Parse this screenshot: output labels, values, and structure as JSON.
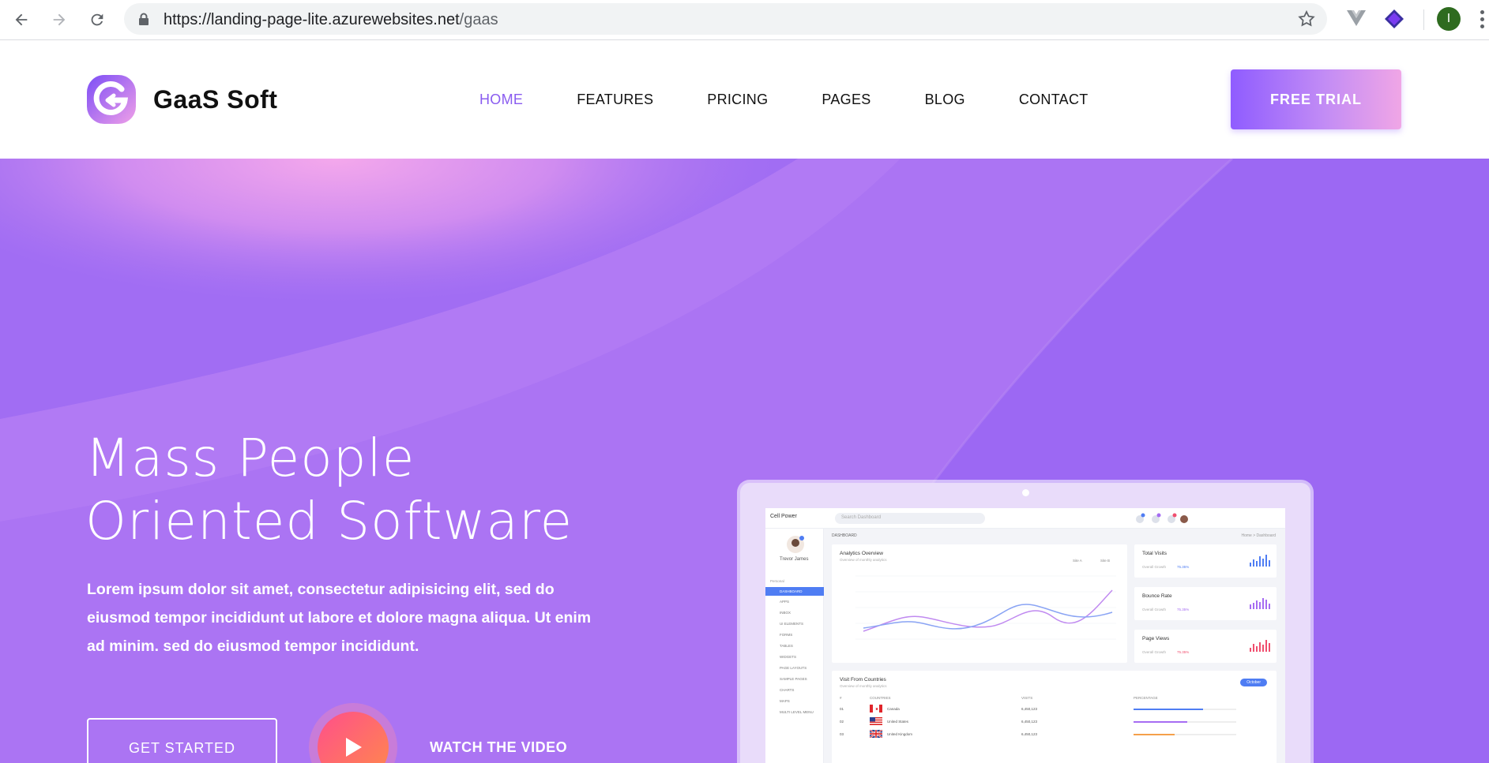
{
  "browser": {
    "url_host": "https://landing-page-lite.azurewebsites.net",
    "url_path": "/gaas",
    "profile_initial": "I"
  },
  "header": {
    "brand": "GaaS Soft",
    "nav": [
      "HOME",
      "FEATURES",
      "PRICING",
      "PAGES",
      "BLOG",
      "CONTACT"
    ],
    "active_nav": "HOME",
    "cta": "FREE TRIAL"
  },
  "hero": {
    "title_line1": "Mass People",
    "title_line2": "Oriented Software",
    "description": "Lorem ipsum dolor sit amet, consectetur adipisicing elit, sed do eiusmod tempor incididunt ut labore et dolore magna aliqua. Ut enim ad minim. sed do eiusmod tempor incididunt.",
    "primary_button": "GET STARTED",
    "video_link": "WATCH THE VIDEO"
  },
  "mockup": {
    "brand": "Cell Power",
    "search_placeholder": "Search Dashboard",
    "user_name": "Trevor James",
    "section_label": "Personal",
    "breadcrumb": "DASHBOARD",
    "breadcrumb_right": "Home  >  Dashboard",
    "sidebar_items": [
      "DASHBOARD",
      "APPS",
      "INBOX",
      "UI ELEMENTS",
      "FORMS",
      "TABLES",
      "WIDGETS",
      "PAGE LAYOUTS",
      "SAMPLE PAGES",
      "CHARTS",
      "MAPS",
      "MULTI LEVEL MENU"
    ],
    "analytics": {
      "title": "Analytics Overview",
      "subtitle": "Overview of monthly analytics",
      "legend": [
        "Site A",
        "Site B"
      ]
    },
    "stats": [
      {
        "title": "Total Visits",
        "sub": "Overall Growth",
        "pct": "75.35%",
        "color": "#4f7df3"
      },
      {
        "title": "Bounce Rate",
        "sub": "Overall Growth",
        "pct": "75.35%",
        "color": "#a66cf2"
      },
      {
        "title": "Page Views",
        "sub": "Overall Growth",
        "pct": "75.35%",
        "color": "#f04f6f"
      }
    ],
    "countries": {
      "title": "Visit From Countries",
      "subtitle": "Overview of monthly analytics",
      "dropdown": "October",
      "headers": [
        "#",
        "COUNTRIES",
        "VISITS",
        "PERCENTAGE"
      ],
      "rows": [
        {
          "n": "01",
          "country": "Canada",
          "visits": "6,450,123",
          "pct": 0.68,
          "color": "#4f7df3"
        },
        {
          "n": "02",
          "country": "United States",
          "visits": "6,450,123",
          "pct": 0.52,
          "color": "#a66cf2"
        },
        {
          "n": "03",
          "country": "United Kingdom",
          "visits": "6,450,123",
          "pct": 0.4,
          "color": "#f5a04a"
        }
      ]
    }
  }
}
